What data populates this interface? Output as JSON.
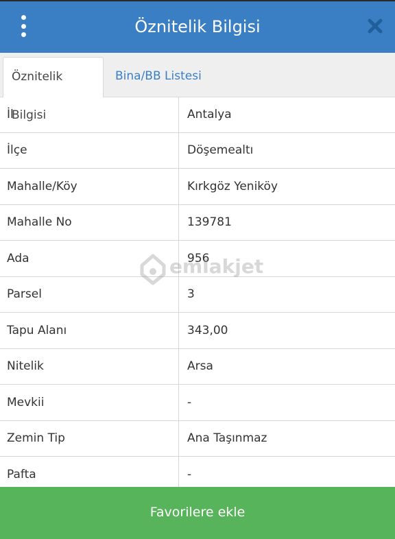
{
  "header": {
    "title": "Öznitelik Bilgisi"
  },
  "icons": {
    "menu": "more-vertical-icon",
    "close": "close-icon"
  },
  "tabs": [
    {
      "label": "Öznitelik Bilgisi",
      "active": true
    },
    {
      "label": "Bina/BB Listesi",
      "active": false
    }
  ],
  "rows": [
    {
      "key": "İl",
      "value": "Antalya"
    },
    {
      "key": "İlçe",
      "value": "Döşemealtı"
    },
    {
      "key": "Mahalle/Köy",
      "value": "Kırkgöz Yeniköy"
    },
    {
      "key": "Mahalle No",
      "value": "139781"
    },
    {
      "key": "Ada",
      "value": "956"
    },
    {
      "key": "Parsel",
      "value": "3"
    },
    {
      "key": "Tapu Alanı",
      "value": "343,00"
    },
    {
      "key": "Nitelik",
      "value": "Arsa"
    },
    {
      "key": "Mevkii",
      "value": "-"
    },
    {
      "key": "Zemin Tip",
      "value": "Ana Taşınmaz"
    },
    {
      "key": "Pafta",
      "value": "-"
    }
  ],
  "watermark": {
    "text": "emlakjet"
  },
  "footer": {
    "favorite_label": "Favorilere ekle"
  },
  "colors": {
    "header": "#3a7fc4",
    "tab_link": "#3a7fc4",
    "favorite_button": "#58b45a"
  }
}
